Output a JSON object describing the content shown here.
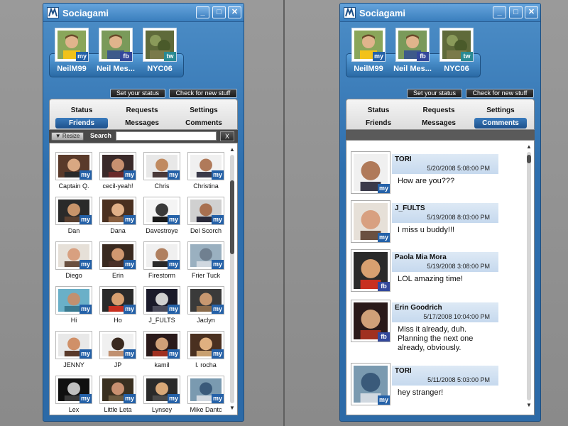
{
  "divider": true,
  "windows": [
    {
      "title": "Sociagami",
      "accounts": [
        {
          "name": "NeilM99",
          "service": "my"
        },
        {
          "name": "Neil Mes...",
          "service": "fb"
        },
        {
          "name": "NYC06",
          "service": "tw"
        }
      ],
      "actions": {
        "set_status": "Set your status",
        "check": "Check for new stuff"
      },
      "tabs": [
        {
          "label": "Status",
          "active": false
        },
        {
          "label": "Requests",
          "active": false
        },
        {
          "label": "Settings",
          "active": false
        },
        {
          "label": "Friends",
          "active": true
        },
        {
          "label": "Messages",
          "active": false
        },
        {
          "label": "Comments",
          "active": false
        }
      ],
      "search": {
        "resize_label": "▼ Resize",
        "label": "Search",
        "value": "",
        "clear_label": "X"
      },
      "friends": [
        {
          "name": "Captain Q.",
          "service": "my"
        },
        {
          "name": "cecil-yeah!",
          "service": "my"
        },
        {
          "name": "Chris",
          "service": "my"
        },
        {
          "name": "Christina",
          "service": "my"
        },
        {
          "name": "Dan",
          "service": "my"
        },
        {
          "name": "Dana",
          "service": "my"
        },
        {
          "name": "Davestroye",
          "service": "my"
        },
        {
          "name": "Del Scorch",
          "service": "my"
        },
        {
          "name": "Diego",
          "service": "my"
        },
        {
          "name": "Erin",
          "service": "my"
        },
        {
          "name": "Firestorm",
          "service": "my"
        },
        {
          "name": "Frier Tuck",
          "service": "my"
        },
        {
          "name": "Hi",
          "service": "my"
        },
        {
          "name": "Ho",
          "service": "my"
        },
        {
          "name": "J_FULTS",
          "service": "my"
        },
        {
          "name": "Jaclyn",
          "service": "my"
        },
        {
          "name": "JENNY",
          "service": "my"
        },
        {
          "name": "JP",
          "service": "my"
        },
        {
          "name": "kamil",
          "service": "my"
        },
        {
          "name": "l. rocha",
          "service": "my"
        },
        {
          "name": "Lex",
          "service": "my"
        },
        {
          "name": "Little Leta",
          "service": "my"
        },
        {
          "name": "Lynsey",
          "service": "my"
        },
        {
          "name": "Mike Dantc",
          "service": "my"
        }
      ]
    },
    {
      "title": "Sociagami",
      "accounts": [
        {
          "name": "NeilM99",
          "service": "my"
        },
        {
          "name": "Neil Mes...",
          "service": "fb"
        },
        {
          "name": "NYC06",
          "service": "tw"
        }
      ],
      "actions": {
        "set_status": "Set your status",
        "check": "Check for new stuff"
      },
      "tabs": [
        {
          "label": "Status",
          "active": false
        },
        {
          "label": "Requests",
          "active": false
        },
        {
          "label": "Settings",
          "active": false
        },
        {
          "label": "Friends",
          "active": false
        },
        {
          "label": "Messages",
          "active": false
        },
        {
          "label": "Comments",
          "active": true
        }
      ],
      "comments": [
        {
          "author": "TORI",
          "date": "5/20/2008 5:08:00 PM",
          "text": "How are you???",
          "service": "my"
        },
        {
          "author": "J_FULTS",
          "date": "5/19/2008 8:03:00 PM",
          "text": "I miss u buddy!!!",
          "service": "my"
        },
        {
          "author": "Paola Mia Mora",
          "date": "5/19/2008 3:08:00 PM",
          "text": "LOL amazing time!",
          "service": "fb"
        },
        {
          "author": "Erin Goodrich",
          "date": "5/17/2008 10:04:00 PM",
          "text": "Miss it already, duh. Planning the next one already, obviously.",
          "service": "fb"
        },
        {
          "author": "TORI",
          "date": "5/11/2008 5:03:00 PM",
          "text": "hey stranger!",
          "service": "my"
        }
      ]
    }
  ],
  "window_controls": {
    "minimize": "_",
    "maximize": "□",
    "close": "✕"
  },
  "scroll": {
    "up": "▲",
    "down": "▼"
  },
  "colors": {
    "window_blue": "#2e6fae",
    "active_tab": "#1d508a",
    "badge_my": "#2461a8",
    "badge_fb": "#33489b",
    "badge_tw": "#2a8a93"
  },
  "icons": {
    "app": "sociagami-logo-icon"
  }
}
